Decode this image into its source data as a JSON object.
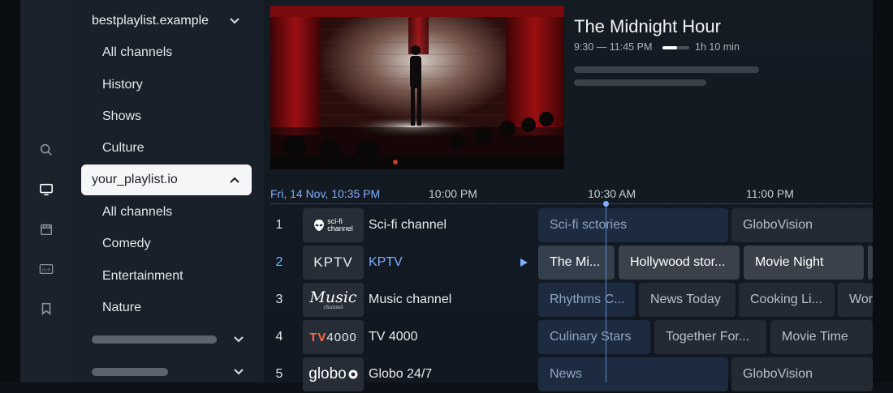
{
  "sidebar": {
    "playlists": [
      {
        "name": "bestplaylist.example",
        "items": [
          "All channels",
          "History",
          "Shows",
          "Culture"
        ]
      },
      {
        "name": "your_playlist.io",
        "items": [
          "All channels",
          "Comedy",
          "Entertainment",
          "Nature"
        ]
      }
    ]
  },
  "rail": {
    "icons": [
      "search-icon",
      "tv-icon",
      "film-icon",
      "dvr-icon",
      "bookmark-icon"
    ]
  },
  "now_playing": {
    "title": "The Midnight Hour",
    "time": "9:30 — 11:45 PM",
    "duration": "1h 10 min",
    "progress": 0.55
  },
  "timeline": {
    "date": "Fri,  14 Nov, 10:35 PM",
    "times": [
      "10:00 PM",
      "10:30 AM",
      "11:00 PM"
    ]
  },
  "channels": [
    {
      "number": "1",
      "name": "Sci-fi channel",
      "logo_line1": "sci-fi",
      "logo_line2": "channel",
      "programs": [
        "Sci-fi sctories",
        "GloboVision"
      ]
    },
    {
      "number": "2",
      "name": "KPTV",
      "logo": "KPTV",
      "programs": [
        "The Mi...",
        "Hollywood stor...",
        "Movie Night"
      ]
    },
    {
      "number": "3",
      "name": "Music channel",
      "logo": "Music",
      "logo_sub": "channel",
      "programs": [
        "Rhythms C...",
        "News Today",
        "Cooking Li...",
        "Wor"
      ]
    },
    {
      "number": "4",
      "name": "TV 4000",
      "logo_a": "TV",
      "logo_b": "4000",
      "programs": [
        "Culinary Stars",
        "Together For...",
        "Movie Time"
      ]
    },
    {
      "number": "5",
      "name": "Globo 24/7",
      "logo": "globo",
      "programs": [
        "News",
        "GloboVision"
      ]
    }
  ],
  "colors": {
    "accent": "#7fb0ff",
    "selected_row": "#3a414a",
    "past_program": "#1d2b40"
  }
}
